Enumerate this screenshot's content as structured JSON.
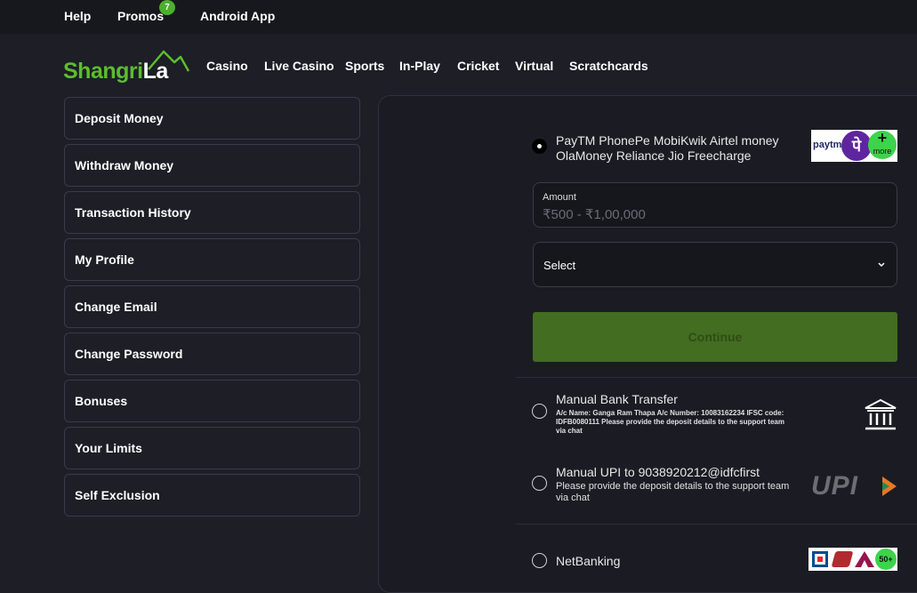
{
  "topbar": {
    "help": "Help",
    "promos": "Promos",
    "promos_count": "7",
    "android_app": "Android App"
  },
  "brand": {
    "name_part1": "Shangri",
    "name_part2": "La"
  },
  "nav": [
    "Casino",
    "Live Casino",
    "Sports",
    "In-Play",
    "Cricket",
    "Virtual",
    "Scratchcards"
  ],
  "sidebar": [
    "Deposit Money",
    "Withdraw Money",
    "Transaction History",
    "My Profile",
    "Change Email",
    "Change Password",
    "Bonuses",
    "Your Limits",
    "Self Exclusion"
  ],
  "deposit": {
    "wallets": {
      "line1": "PayTM PhonePe MobiKwik Airtel money",
      "line2": "OlaMoney Reliance Jio Freecharge",
      "logo_paytm": "paytm",
      "logo_phonepe": "पे",
      "logo_more_plus": "+",
      "logo_more": "more"
    },
    "amount_label": "Amount",
    "amount_placeholder": "₹500 - ₹1,00,000",
    "select_label": "Select",
    "continue_label": "Continue",
    "bank": {
      "title": "Manual Bank Transfer",
      "details_line1": "A/c Name: Ganga Ram Thapa A/c Number: 10083162234 IFSC code:",
      "details_line2": "IDFB0080111 Please provide the deposit details to the support team",
      "details_line3": "via chat"
    },
    "upi": {
      "title": "Manual UPI to 9038920212@idfcfirst",
      "note_line1": "Please provide the deposit details to the support team",
      "note_line2": "via chat",
      "logo_text": "UPI"
    },
    "netbanking": {
      "title": "NetBanking",
      "badge": "50+"
    }
  },
  "colors": {
    "accent_green": "#5cbd2e",
    "continue_bg": "#436d21",
    "page_bg": "#1d1e26"
  }
}
